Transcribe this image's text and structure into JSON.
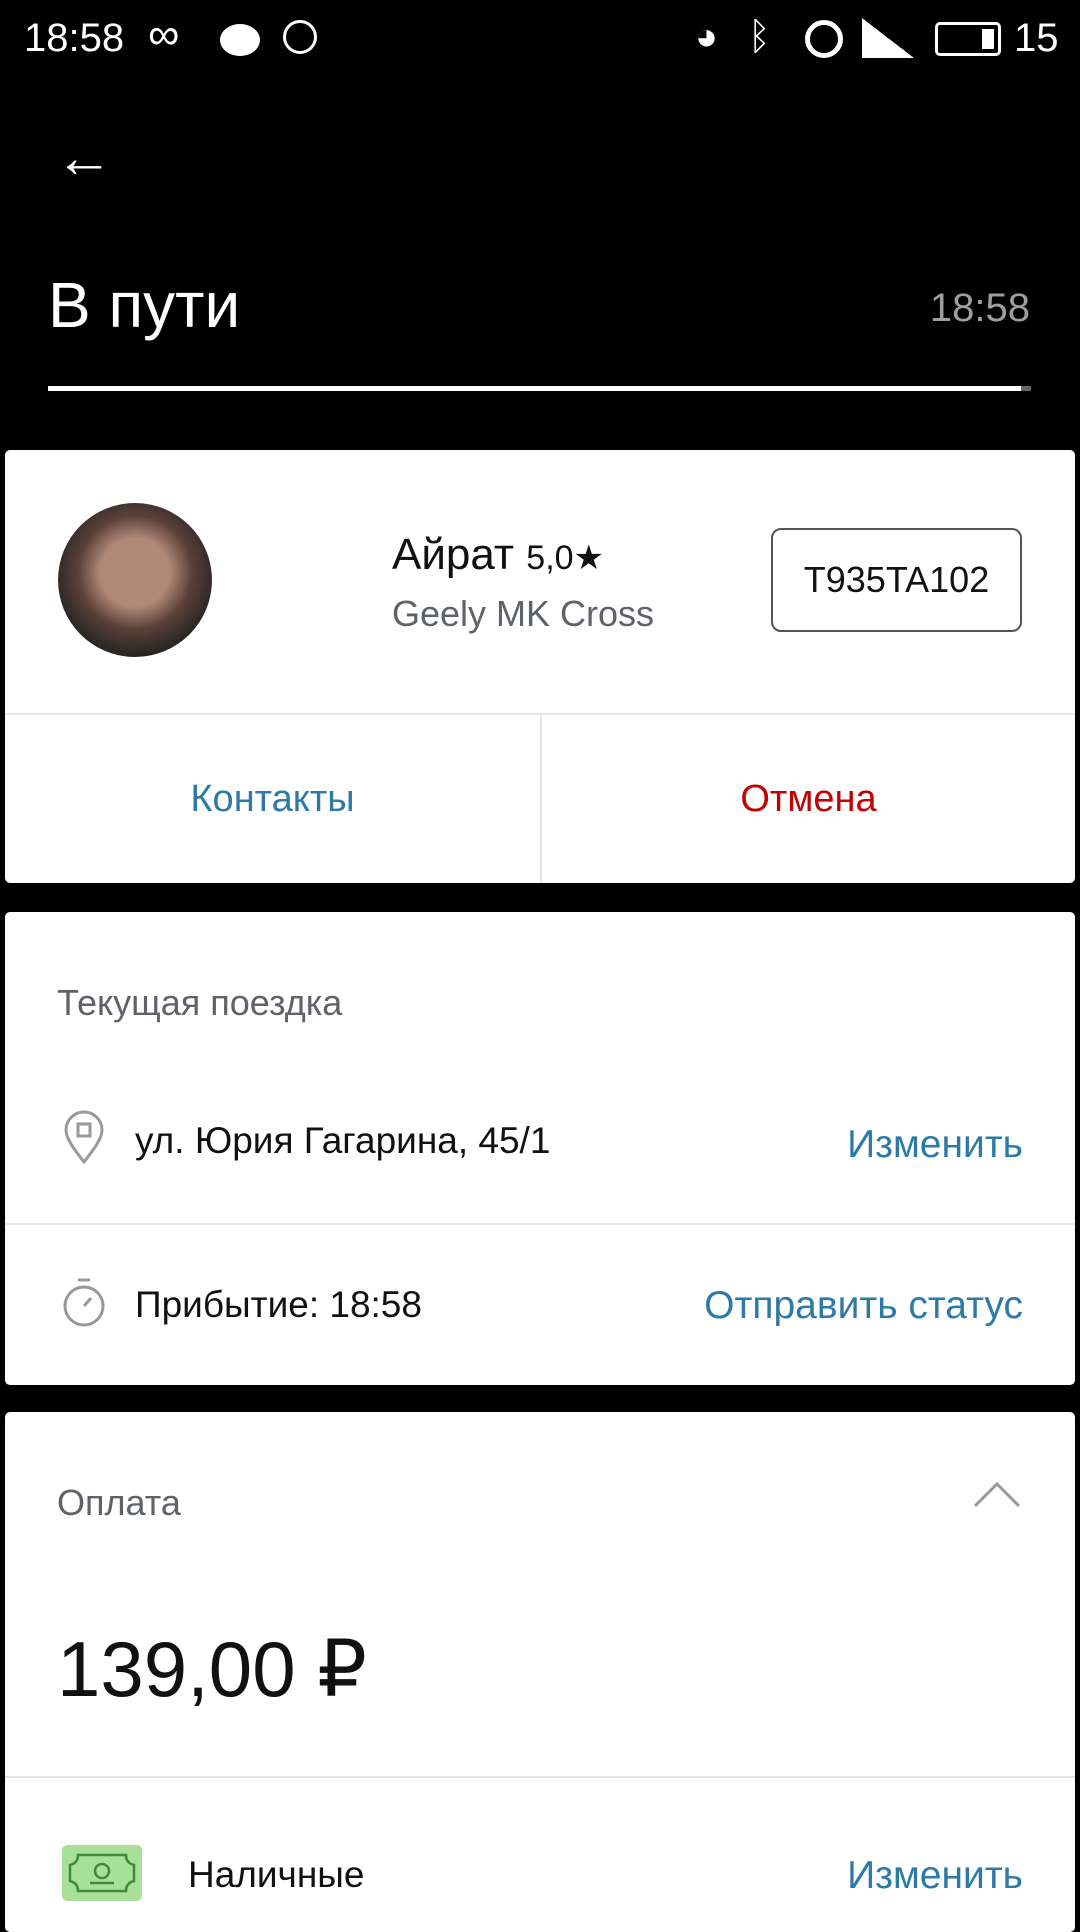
{
  "status_bar": {
    "time": "18:58",
    "battery": "15",
    "icons": [
      "infinity-icon",
      "message-icon",
      "whatsapp-icon",
      "location-icon",
      "bluetooth-icon",
      "alarm-icon",
      "signal-icon",
      "battery-icon"
    ]
  },
  "header": {
    "title": "В пути",
    "time": "18:58",
    "progress": 0.99
  },
  "driver": {
    "name": "Айрат",
    "rating": "5,0★",
    "car": "Geely MK Cross",
    "plate": "T935TA102",
    "contacts_label": "Контакты",
    "cancel_label": "Отмена"
  },
  "trip": {
    "title": "Текущая поездка",
    "address": "ул. Юрия Гагарина, 45/1",
    "change_label": "Изменить",
    "arrival": "Прибытие: 18:58",
    "send_status_label": "Отправить статус"
  },
  "payment": {
    "title": "Оплата",
    "amount": "139,00 ₽",
    "method": "Наличные",
    "change_label": "Изменить"
  },
  "colors": {
    "link": "#2e7aa6",
    "cancel": "#c40000",
    "cash_icon_bg": "#a8e09a"
  }
}
